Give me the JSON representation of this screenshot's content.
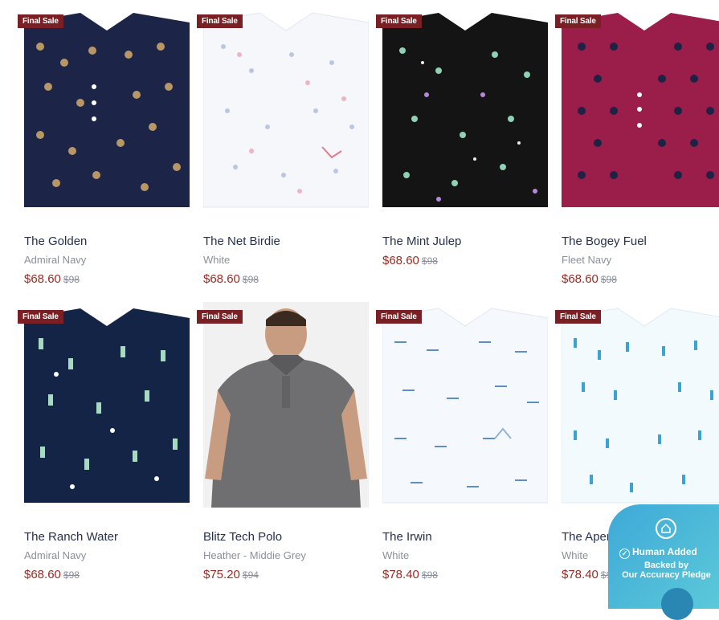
{
  "badge_label": "Final Sale",
  "pledge": {
    "title": "Human Added",
    "line1": "Backed by",
    "line2": "Our Accuracy Pledge"
  },
  "products": [
    {
      "name": "The Golden",
      "color": "Admiral Navy",
      "price": "$68.60",
      "original": "$98",
      "badge": true,
      "pattern": "navy-tan"
    },
    {
      "name": "The Net Birdie",
      "color": "White",
      "price": "$68.60",
      "original": "$98",
      "badge": true,
      "pattern": "white-pink"
    },
    {
      "name": "The Mint Julep",
      "color": "",
      "price": "$68.60",
      "original": "$98",
      "badge": true,
      "pattern": "black-mint"
    },
    {
      "name": "The Bogey Fuel",
      "color": "Fleet Navy",
      "price": "$68.60",
      "original": "$98",
      "badge": true,
      "pattern": "magenta"
    },
    {
      "name": "The Ranch Water",
      "color": "Admiral Navy",
      "price": "$68.60",
      "original": "$98",
      "badge": true,
      "pattern": "navy-mint"
    },
    {
      "name": "Blitz Tech Polo",
      "color": "Heather - Middie Grey",
      "price": "$75.20",
      "original": "$94",
      "badge": true,
      "pattern": "model-grey"
    },
    {
      "name": "The Irwin",
      "color": "White",
      "price": "$78.40",
      "original": "$98",
      "badge": true,
      "pattern": "white-blue"
    },
    {
      "name": "The Aperitif",
      "color": "White",
      "price": "$78.40",
      "original": "$98",
      "badge": true,
      "pattern": "white-cyan"
    }
  ]
}
